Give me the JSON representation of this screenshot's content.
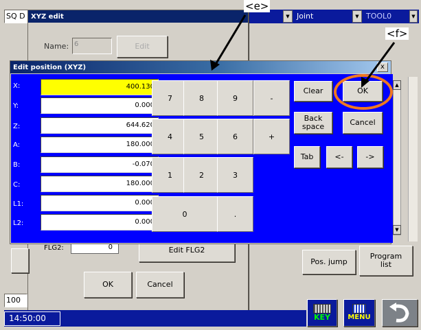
{
  "topbar": {
    "left_text": "SQ D",
    "joint_value": "Joint",
    "tool_value": "TOOL0"
  },
  "xyz_edit": {
    "title": "XYZ edit",
    "name_label": "Name:",
    "name_value": "6",
    "edit_button": "Edit",
    "flg2_label": "FLG2:",
    "flg2_value": "0",
    "edit_flg2_button": "Edit FLG2",
    "ok_button": "OK",
    "cancel_button": "Cancel"
  },
  "edit_position": {
    "title": "Edit position (XYZ)",
    "close_label": "x",
    "fields": [
      {
        "label": "X:",
        "value": "400.130"
      },
      {
        "label": "Y:",
        "value": "0.000"
      },
      {
        "label": "Z:",
        "value": "644.620"
      },
      {
        "label": "A:",
        "value": "180.000"
      },
      {
        "label": "B:",
        "value": "-0.070"
      },
      {
        "label": "C:",
        "value": "180.000"
      },
      {
        "label": "L1:",
        "value": "0.000"
      },
      {
        "label": "L2:",
        "value": "0.000"
      }
    ],
    "keys": {
      "k7": "7",
      "k8": "8",
      "k9": "9",
      "minus": "-",
      "k4": "4",
      "k5": "5",
      "k6": "6",
      "plus": "+",
      "k1": "1",
      "k2": "2",
      "k3": "3",
      "k0": "0",
      "dot": "."
    },
    "clear": "Clear",
    "ok": "OK",
    "backspace": "Back\nspace",
    "cancel": "Cancel",
    "tab": "Tab",
    "left_arrow": "<-",
    "right_arrow": "->"
  },
  "right_panel": {
    "pos_jump": "Pos. jump",
    "program_list": "Program\nlist"
  },
  "statusbar": {
    "zoom": "100",
    "time": "14:50:00",
    "key_label": "KEY",
    "menu_label": "MENU"
  },
  "annotations": {
    "e": "<e>",
    "f": "<f>"
  },
  "colors": {
    "dialog_blue": "#0000ff",
    "title_blue": "#0a246a",
    "highlight_yellow": "#ffff00",
    "callout_orange": "#f07820",
    "key_green": "#00ff00",
    "menu_yellow": "#ffff00"
  }
}
